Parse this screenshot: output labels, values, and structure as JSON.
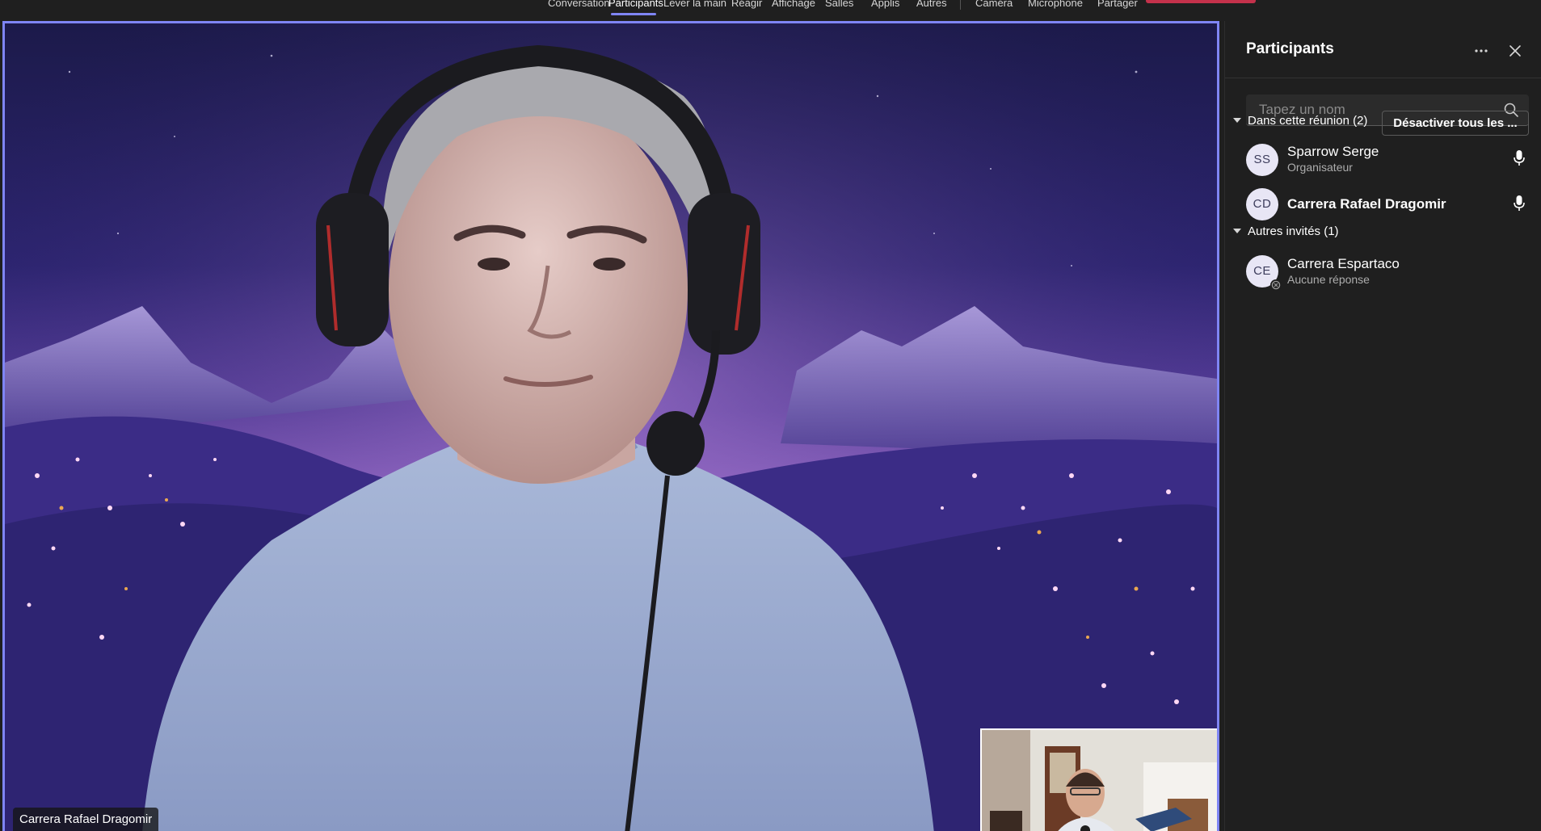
{
  "toolbar": {
    "items": [
      {
        "label": "Conversation"
      },
      {
        "label": "Participants"
      },
      {
        "label": "Lever la main"
      },
      {
        "label": "Réagir"
      },
      {
        "label": "Affichage"
      },
      {
        "label": "Salles"
      },
      {
        "label": "Applis"
      },
      {
        "label": "Autres"
      },
      {
        "label": "Caméra"
      },
      {
        "label": "Microphone"
      },
      {
        "label": "Partager"
      }
    ],
    "active_item": "Participants",
    "accent_color": "#7f85f5",
    "leave_color": "#c4314b"
  },
  "stage": {
    "speaker_name": "Carrera Rafael Dragomir",
    "border_color": "#7f85f5"
  },
  "panel": {
    "title": "Participants",
    "search_placeholder": "Tapez un nom",
    "in_meeting_label": "Dans cette réunion (2)",
    "mute_all_label": "Désactiver tous les ...",
    "others_label": "Autres invités (1)",
    "in_meeting": [
      {
        "initials": "SS",
        "name": "Sparrow Serge",
        "role": "Organisateur",
        "icon": "microphone-icon"
      },
      {
        "initials": "CD",
        "name": "Carrera Rafael Dragomir",
        "role": "",
        "icon": "microphone-icon"
      }
    ],
    "others": [
      {
        "initials": "CE",
        "name": "Carrera Espartaco",
        "status": "Aucune réponse",
        "icon": "unavailable-status-icon"
      }
    ]
  }
}
